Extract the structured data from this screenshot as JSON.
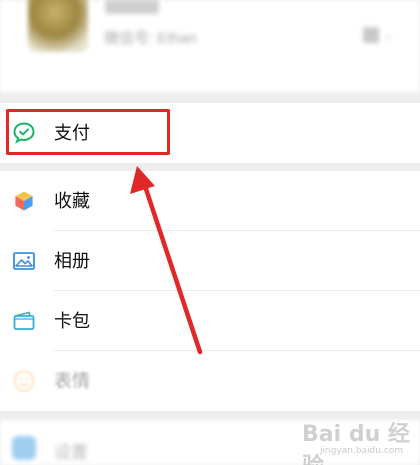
{
  "profile": {
    "name": "",
    "id_text": "微信号: Ethan",
    "chevron": "›"
  },
  "pay": {
    "label": "支付"
  },
  "menu": {
    "items": [
      {
        "label": "收藏",
        "icon": "favorites-cube-icon"
      },
      {
        "label": "相册",
        "icon": "album-picture-icon"
      },
      {
        "label": "卡包",
        "icon": "card-wallet-icon"
      },
      {
        "label": "表情",
        "icon": "emoji-sticker-icon"
      }
    ]
  },
  "bottom": {
    "label": "设置"
  },
  "watermark": {
    "text": "Bai du 经验",
    "sub": "jingyan.baidu.com"
  },
  "colors": {
    "annotation_red": "#e02827",
    "pay_green": "#19b36b",
    "background": "#ededed"
  }
}
